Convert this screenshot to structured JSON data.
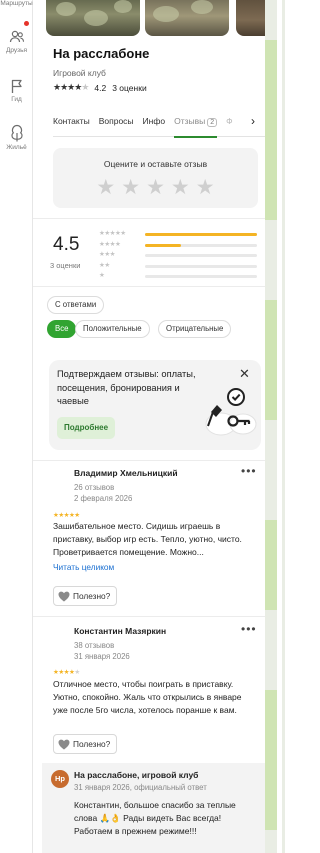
{
  "rail": {
    "items": [
      {
        "label": "Маршруты",
        "icon": "route-icon"
      },
      {
        "label": "Друзья",
        "icon": "friends-icon"
      },
      {
        "label": "Гид",
        "icon": "flag-icon"
      },
      {
        "label": "Жильё",
        "icon": "tree-icon"
      }
    ],
    "notification_color": "#e5332a"
  },
  "place": {
    "title": "На расслабоне",
    "category": "Игровой клуб",
    "rating": "4.2",
    "rating_stars": 4,
    "rating_count": "3 оценки"
  },
  "tabs": [
    {
      "label": "Контакты",
      "active": false
    },
    {
      "label": "Вопросы",
      "active": false
    },
    {
      "label": "Инфо",
      "active": false
    },
    {
      "label": "Отзывы",
      "count": "2",
      "active": true
    },
    {
      "label": "Ф",
      "active": false
    }
  ],
  "rate_box": {
    "label": "Оцените и оставьте отзыв",
    "stars": "★★★★★"
  },
  "summary": {
    "score": "4.5",
    "count": "3 оценки",
    "distribution": [
      {
        "stars": "★★★★★",
        "fraction": 1.0
      },
      {
        "stars": "★★★★",
        "fraction": 0.32
      },
      {
        "stars": "★★★",
        "fraction": 0
      },
      {
        "stars": "★★",
        "fraction": 0
      },
      {
        "stars": "★",
        "fraction": 0
      }
    ]
  },
  "filters": {
    "with_answers": "С ответами",
    "all": "Все",
    "positive": "Положительные",
    "negative": "Отрицательные"
  },
  "promo": {
    "text": "Подтверждаем отзывы: оплаты, посещения, бронирования и чаевые",
    "button": "Подробнее"
  },
  "reviews": [
    {
      "author": "Владимир Хмельницкий",
      "reviews_count": "26 отзывов",
      "date": "2 февраля 2026",
      "stars": "★★★★★",
      "text": "Зашибательное место. Сидишь играешь в приставку, выбор игр есть. Тепло, уютно, чисто. Проветривается помещение. Можно...",
      "read_more": "Читать целиком",
      "helpful": "Полезно?",
      "more": "•••"
    },
    {
      "author": "Константин Мазяркин",
      "reviews_count": "38 отзывов",
      "date": "31 января 2026",
      "stars": "★★★★",
      "text": "Отличное место, чтобы поиграть в приставку. Уютно, спокойно. Жаль что открылись в январе уже после 5го числа, хотелось поранше к вам.",
      "helpful": "Полезно?",
      "more": "•••"
    }
  ],
  "owner_answer": {
    "avatar": "Нр",
    "name": "На расслабоне, игровой клуб",
    "meta": "31 января 2026, официальный ответ",
    "text": "Константин, большое спасибо за теплые слова 🙏👌 Рады видеть Вас всегда! Работаем в прежнем режиме!!!"
  },
  "colors": {
    "accent_green": "#31a431",
    "star_yellow": "#f4b424",
    "link_blue": "#1a6fd1",
    "avatar_orange": "#c76b2e"
  }
}
